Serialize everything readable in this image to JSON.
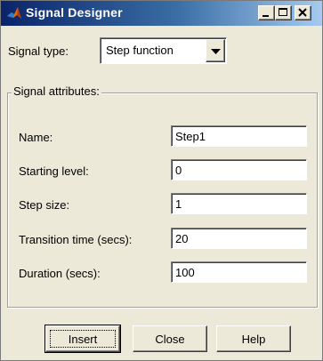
{
  "window": {
    "title": "Signal Designer",
    "icon": "matlab-logo-icon",
    "controls": [
      "minimize-icon",
      "maximize-icon",
      "close-icon"
    ]
  },
  "signal_type": {
    "label": "Signal type:",
    "selected": "Step function"
  },
  "attributes": {
    "group_label": "Signal attributes:",
    "fields": [
      {
        "label": "Name:",
        "value": "Step1"
      },
      {
        "label": "Starting level:",
        "value": "0"
      },
      {
        "label": "Step size:",
        "value": "1"
      },
      {
        "label": "Transition time (secs):",
        "value": "20"
      },
      {
        "label": "Duration (secs):",
        "value": "100"
      }
    ]
  },
  "buttons": {
    "insert": "Insert",
    "close": "Close",
    "help": "Help"
  }
}
